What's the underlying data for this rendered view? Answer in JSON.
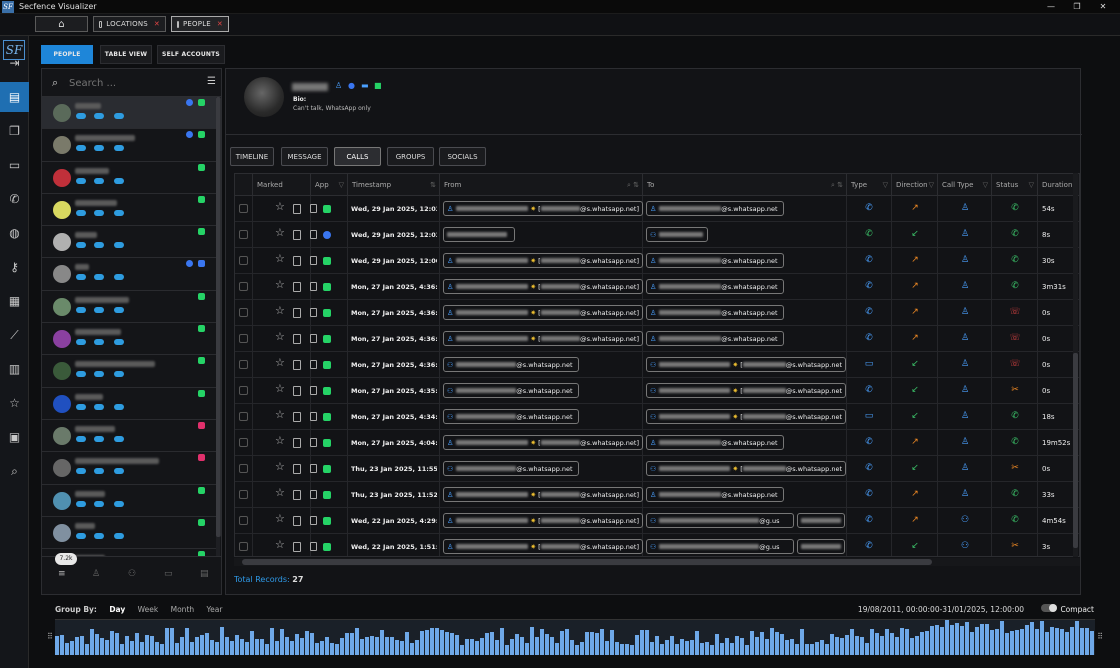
{
  "app": {
    "title": "Secfence Visualizer",
    "logo": "SF"
  },
  "window_controls": [
    "minimize-icon",
    "maximize-icon",
    "close-icon"
  ],
  "top_tabs": [
    {
      "label": "",
      "icon": "home-icon"
    },
    {
      "label": "LOCATIONS",
      "icon": "tab-icon",
      "close": "✕"
    },
    {
      "label": "PEOPLE",
      "icon": "tab-icon",
      "close": "✕"
    }
  ],
  "rail": [
    "logout-icon",
    "contacts-book-icon",
    "folders-icon",
    "message-icon",
    "phone-icon",
    "globe-icon",
    "key-icon",
    "map-icon",
    "chart-line-icon",
    "notes-icon",
    "star-icon",
    "image-icon",
    "search-icon"
  ],
  "view_pills": [
    "PEOPLE",
    "TABLE VIEW",
    "SELF ACCOUNTS"
  ],
  "search": {
    "placeholder": "Search ..."
  },
  "contacts_count": "7.2k",
  "profile": {
    "bio_label": "Bio:",
    "bio_text": "Can't talk, WhatsApp only"
  },
  "detail_tabs": [
    "TIMELINE",
    "MESSAGE",
    "CALLS",
    "GROUPS",
    "SOCIALS"
  ],
  "active_detail_tab": "CALLS",
  "columns": [
    "Marked",
    "App",
    "Timestamp",
    "From",
    "To",
    "Type",
    "Direction",
    "Call Type",
    "Status",
    "Duration"
  ],
  "rows": [
    {
      "app": "whatsapp",
      "ts": "Wed, 29 Jan 2025, 12:03:3",
      "from": "@s.whatsapp.net",
      "to": "@s.whatsapp.net",
      "type": "incoming",
      "dir": "out",
      "ct": "person",
      "status": "answered",
      "dur": "54s"
    },
    {
      "app": "signal",
      "ts": "Wed, 29 Jan 2025, 12:03:2",
      "from": "",
      "to": "",
      "type": "voice",
      "dir": "in",
      "ct": "person",
      "status": "answered",
      "dur": "8s"
    },
    {
      "app": "whatsapp",
      "ts": "Wed, 29 Jan 2025, 12:00:2",
      "from": "@s.whatsapp.net",
      "to": "@s.whatsapp.net",
      "type": "incoming",
      "dir": "out",
      "ct": "person",
      "status": "answered",
      "dur": "30s"
    },
    {
      "app": "whatsapp",
      "ts": "Mon, 27 Jan 2025, 4:36:58",
      "from": "@s.whatsapp.net",
      "to": "@s.whatsapp.net",
      "type": "incoming",
      "dir": "out",
      "ct": "person",
      "status": "answered",
      "dur": "3m31s"
    },
    {
      "app": "whatsapp",
      "ts": "Mon, 27 Jan 2025, 4:36:43",
      "from": "@s.whatsapp.net",
      "to": "@s.whatsapp.net",
      "type": "incoming",
      "dir": "out",
      "ct": "person",
      "status": "declined",
      "dur": "0s"
    },
    {
      "app": "whatsapp",
      "ts": "Mon, 27 Jan 2025, 4:36:31",
      "from": "@s.whatsapp.net",
      "to": "@s.whatsapp.net",
      "type": "incoming",
      "dir": "out",
      "ct": "person",
      "status": "declined",
      "dur": "0s"
    },
    {
      "app": "whatsapp",
      "ts": "Mon, 27 Jan 2025, 4:36:18",
      "from": "@s.whatsapp.net",
      "to": "@s.whatsapp.net",
      "type": "video",
      "dir": "in",
      "ct": "person",
      "status": "declined",
      "dur": "0s"
    },
    {
      "app": "whatsapp",
      "ts": "Mon, 27 Jan 2025, 4:35:18",
      "from": "@s.whatsapp.net",
      "to": "@s.whatsapp.net",
      "type": "incoming",
      "dir": "in",
      "ct": "person",
      "status": "missed",
      "dur": "0s"
    },
    {
      "app": "whatsapp",
      "ts": "Mon, 27 Jan 2025, 4:34:48",
      "from": "@s.whatsapp.net",
      "to": "@s.whatsapp.net",
      "type": "video",
      "dir": "in",
      "ct": "person",
      "status": "answered",
      "dur": "18s"
    },
    {
      "app": "whatsapp",
      "ts": "Mon, 27 Jan 2025, 4:04:07",
      "from": "@s.whatsapp.net",
      "to": "@s.whatsapp.net",
      "type": "incoming",
      "dir": "out",
      "ct": "person",
      "status": "answered",
      "dur": "19m52s"
    },
    {
      "app": "whatsapp",
      "ts": "Thu, 23 Jan 2025, 11:55:53",
      "from": "@s.whatsapp.net",
      "to": "@s.whatsapp.net",
      "type": "incoming",
      "dir": "in",
      "ct": "person",
      "status": "missed",
      "dur": "0s"
    },
    {
      "app": "whatsapp",
      "ts": "Thu, 23 Jan 2025, 11:52:36",
      "from": "@s.whatsapp.net",
      "to": "@s.whatsapp.net",
      "type": "incoming",
      "dir": "out",
      "ct": "person",
      "status": "answered",
      "dur": "33s"
    },
    {
      "app": "whatsapp",
      "ts": "Wed, 22 Jan 2025, 4:29:49",
      "from": "@s.whatsapp.net",
      "to": "@g.us",
      "type": "incoming",
      "dir": "out",
      "ct": "group",
      "status": "answered",
      "dur": "4m54s"
    },
    {
      "app": "whatsapp",
      "ts": "Wed, 22 Jan 2025, 1:51:27 p",
      "from": "@s.whatsapp.net",
      "to": "@g.us",
      "type": "incoming",
      "dir": "in",
      "ct": "group",
      "status": "missed",
      "dur": "3s"
    }
  ],
  "total_records_label": "Total Records:",
  "total_records": "27",
  "group_by": {
    "label": "Group By:",
    "options": [
      "Day",
      "Week",
      "Month",
      "Year"
    ],
    "active": "Day"
  },
  "date_range": "19/08/2011, 00:00:00-31/01/2025, 12:00:00",
  "compact_label": "Compact",
  "colors": {
    "accent": "#1e86d9",
    "whatsapp": "#25d366",
    "signal": "#3a76f0",
    "instagram": "#e1306c",
    "danger": "#e04444",
    "orange": "#f08a24",
    "green": "#3cc46a"
  }
}
